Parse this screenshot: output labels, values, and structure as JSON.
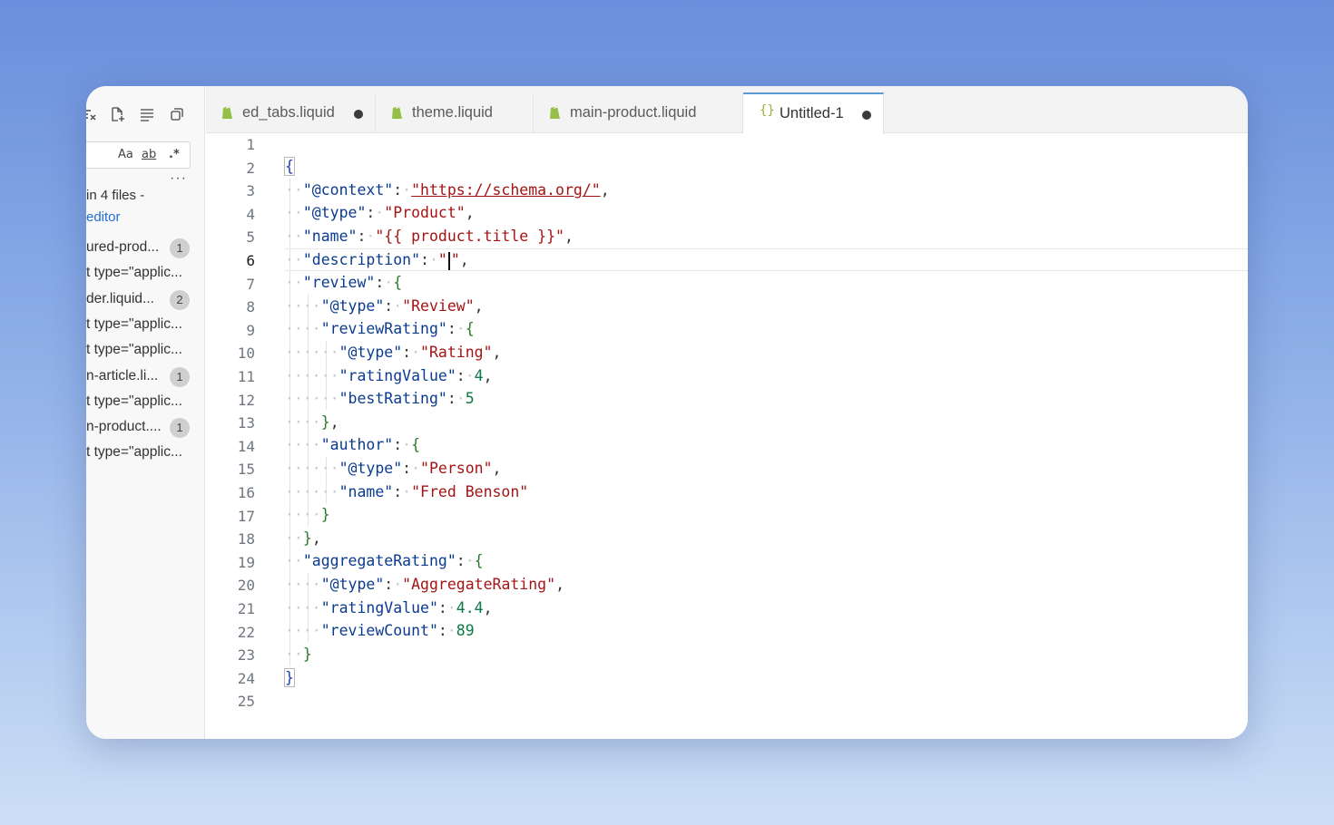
{
  "sidebar": {
    "toolbar_icons": [
      "clear-results-icon",
      "new-search-editor-icon",
      "collapse-all-icon",
      "open-in-editor-icon"
    ],
    "search_options": {
      "match_case": "Aa",
      "whole_word": "ab",
      "regex": ".*"
    },
    "more": "···",
    "summary": "in 4 files -",
    "summary_link": "editor",
    "results": [
      {
        "text": "ured-prod...",
        "badge": "1"
      },
      {
        "text": "t type=\"applic...",
        "badge": ""
      },
      {
        "text": "der.liquid...",
        "badge": "2"
      },
      {
        "text": "t type=\"applic...",
        "badge": ""
      },
      {
        "text": "t type=\"applic...",
        "badge": ""
      },
      {
        "text": "n-article.li...",
        "badge": "1"
      },
      {
        "text": "t type=\"applic...",
        "badge": ""
      },
      {
        "text": "n-product....",
        "badge": "1"
      },
      {
        "text": "t type=\"applic...",
        "badge": ""
      }
    ]
  },
  "tabs": [
    {
      "label": "ed_tabs.liquid",
      "icon": "shopify-liquid-icon",
      "dirty": true,
      "active": false
    },
    {
      "label": "theme.liquid",
      "icon": "shopify-liquid-icon",
      "dirty": false,
      "active": false
    },
    {
      "label": "main-product.liquid",
      "icon": "shopify-liquid-icon",
      "dirty": false,
      "active": false
    },
    {
      "label": "Untitled-1",
      "icon": "json-braces-icon",
      "json_glyph": "{}",
      "dirty": true,
      "active": true
    }
  ],
  "editor": {
    "current_line": 6,
    "line_numbers": [
      "1",
      "2",
      "3",
      "4",
      "5",
      "6",
      "7",
      "8",
      "9",
      "10",
      "11",
      "12",
      "13",
      "14",
      "15",
      "16",
      "17",
      "18",
      "19",
      "20",
      "21",
      "22",
      "23",
      "24",
      "25"
    ],
    "code": {
      "l2_open": "{",
      "context_key": "\"@context\"",
      "context_val": "\"https://schema.org/\"",
      "type_key": "\"@type\"",
      "type_val": "\"Product\"",
      "name_key": "\"name\"",
      "name_val": "\"{{ product.title }}\"",
      "desc_key": "\"description\"",
      "desc_val_open": "\"",
      "desc_val_close": "\"",
      "review_key": "\"review\"",
      "review_type_key": "\"@type\"",
      "review_type_val": "\"Review\"",
      "review_rating_key": "\"reviewRating\"",
      "rating_type_key": "\"@type\"",
      "rating_type_val": "\"Rating\"",
      "rating_value_key": "\"ratingValue\"",
      "rating_value": "4",
      "best_rating_key": "\"bestRating\"",
      "best_rating": "5",
      "author_key": "\"author\"",
      "person_type_key": "\"@type\"",
      "person_type_val": "\"Person\"",
      "person_name_key": "\"name\"",
      "person_name_val": "\"Fred Benson\"",
      "agg_key": "\"aggregateRating\"",
      "agg_type_key": "\"@type\"",
      "agg_type_val": "\"AggregateRating\"",
      "agg_value_key": "\"ratingValue\"",
      "agg_value": "4.4",
      "review_count_key": "\"reviewCount\"",
      "review_count": "89",
      "l24_close": "}"
    }
  },
  "colors": {
    "key": "#0b3b8f",
    "string": "#a31515",
    "number": "#0b7a45",
    "brace": "#2b7a2b",
    "accent": "#5b9bd5",
    "liquid_icon": "#95bf47"
  }
}
